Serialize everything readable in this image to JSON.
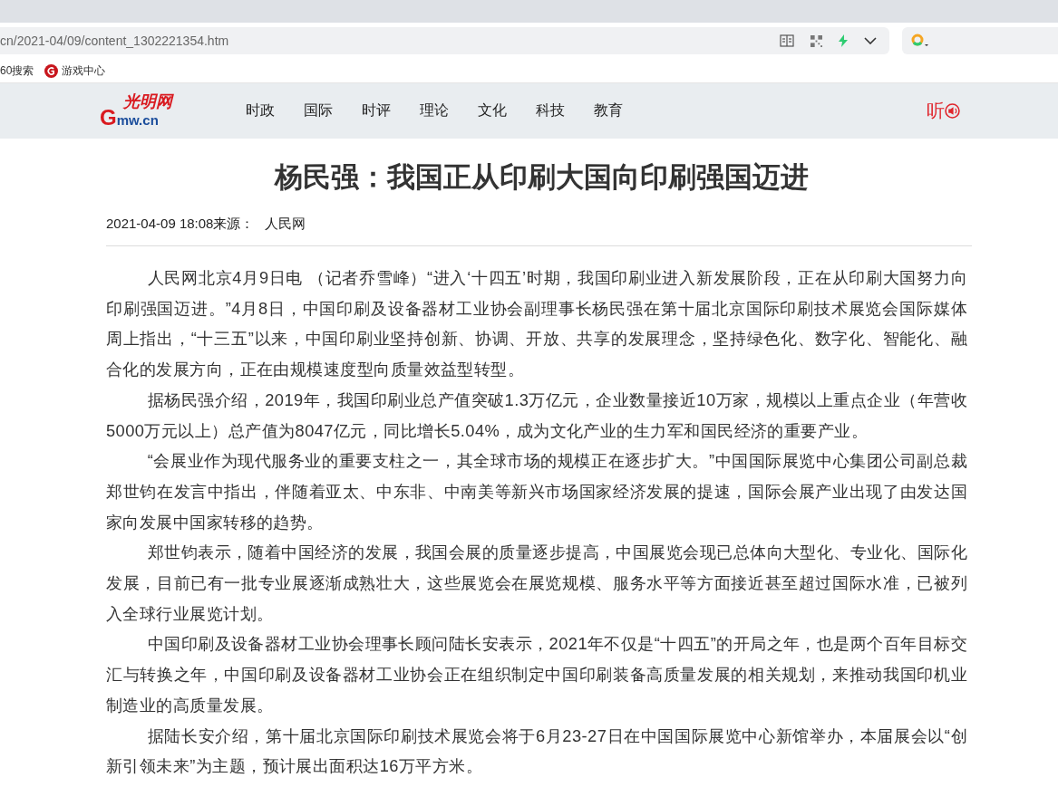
{
  "browser": {
    "url": "cn/2021-04/09/content_1302221354.htm",
    "bookmarks": [
      {
        "label": "60搜索",
        "kind": "plain"
      },
      {
        "label": "游戏中心",
        "kind": "game"
      }
    ]
  },
  "site_header": {
    "logo": {
      "script": "光明网",
      "initial": "G",
      "domain": "mw.cn"
    },
    "nav": [
      {
        "label": "时政"
      },
      {
        "label": "国际"
      },
      {
        "label": "时评"
      },
      {
        "label": "理论"
      },
      {
        "label": "文化"
      },
      {
        "label": "科技"
      },
      {
        "label": "教育"
      }
    ],
    "listen": "听"
  },
  "article": {
    "title": "杨民强：我国正从印刷大国向印刷强国迈进",
    "date": "2021-04-09 18:08",
    "source_label": "来源：",
    "source": "人民网",
    "paragraphs": [
      "人民网北京4月9日电 （记者乔雪峰）“进入‘十四五’时期，我国印刷业进入新发展阶段，正在从印刷大国努力向印刷强国迈进。”4月8日，中国印刷及设备器材工业协会副理事长杨民强在第十届北京国际印刷技术展览会国际媒体周上指出，“十三五”以来，中国印刷业坚持创新、协调、开放、共享的发展理念，坚持绿色化、数字化、智能化、融合化的发展方向，正在由规模速度型向质量效益型转型。",
      "据杨民强介绍，2019年，我国印刷业总产值突破1.3万亿元，企业数量接近10万家，规模以上重点企业（年营收5000万元以上）总产值为8047亿元，同比增长5.04%，成为文化产业的生力军和国民经济的重要产业。",
      " “会展业作为现代服务业的重要支柱之一，其全球市场的规模正在逐步扩大。”中国国际展览中心集团公司副总裁郑世钧在发言中指出，伴随着亚太、中东非、中南美等新兴市场国家经济发展的提速，国际会展产业出现了由发达国家向发展中国家转移的趋势。",
      "郑世钧表示，随着中国经济的发展，我国会展的质量逐步提高，中国展览会现已总体向大型化、专业化、国际化发展，目前已有一批专业展逐渐成熟壮大，这些展览会在展览规模、服务水平等方面接近甚至超过国际水准，已被列入全球行业展览计划。",
      "中国印刷及设备器材工业协会理事长顾问陆长安表示，2021年不仅是“十四五”的开局之年，也是两个百年目标交汇与转换之年，中国印刷及设备器材工业协会正在组织制定中国印刷装备高质量发展的相关规划，来推动我国印机业制造业的高质量发展。",
      "据陆长安介绍，第十届北京国际印刷技术展览会将于6月23-27日在中国国际展览中心新馆举办，本届展会以“创新引领未来”为主题，预计展出面积达16万平方米。"
    ]
  }
}
